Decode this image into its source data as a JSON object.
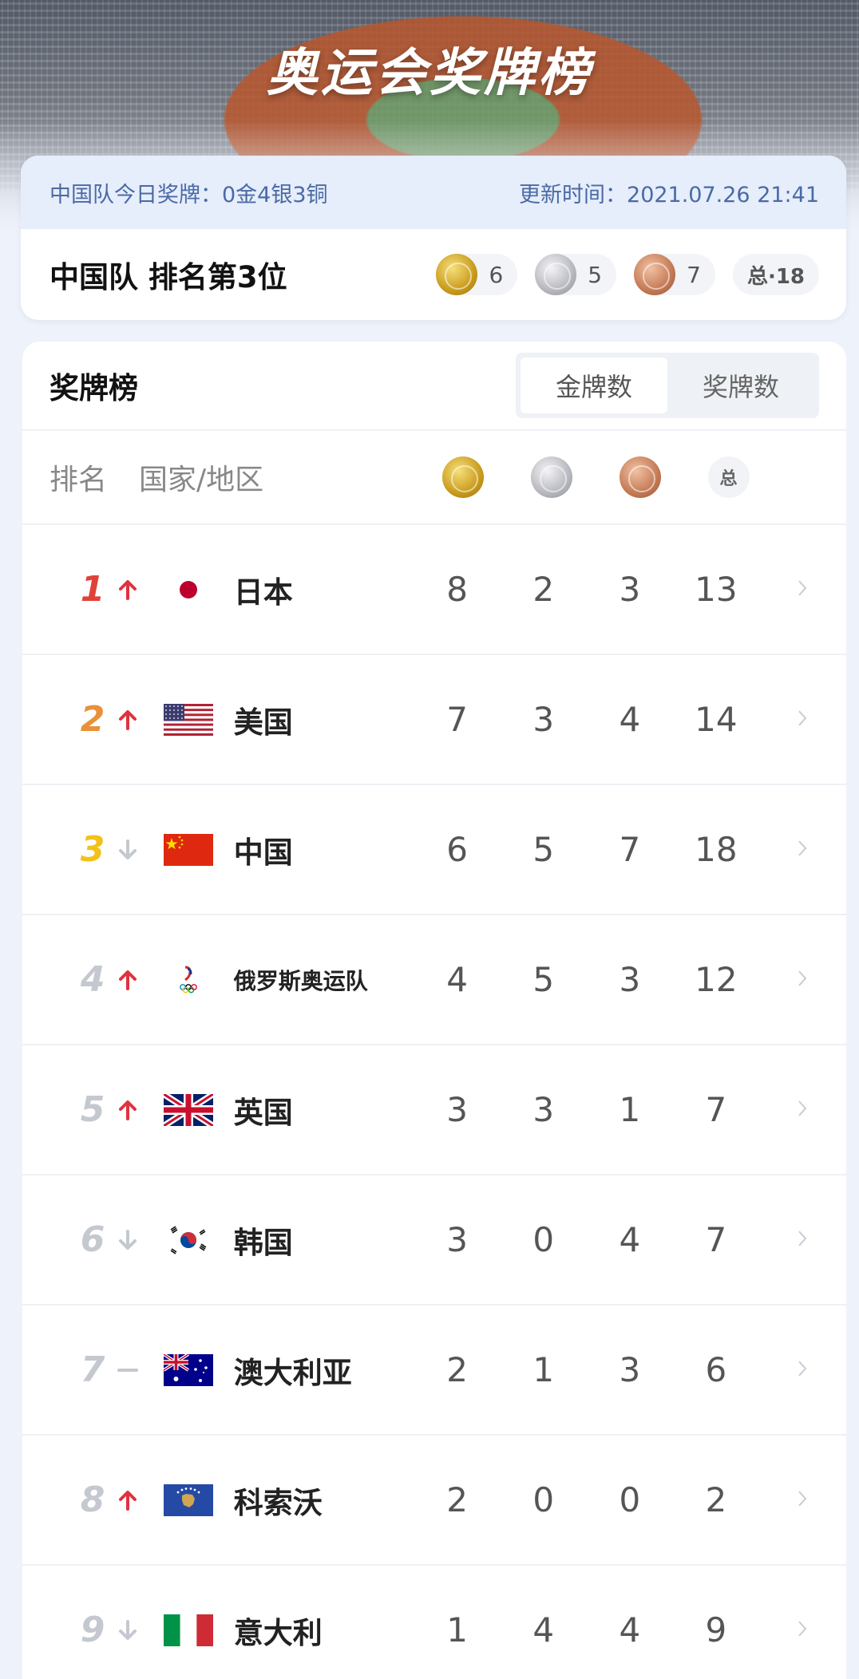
{
  "header": {
    "title": "奥运会奖牌榜"
  },
  "summary": {
    "today_label": "中国队今日奖牌：0金4银3铜",
    "update_label": "更新时间：2021.07.26 21:41",
    "rank_title": "中国队 排名第3位",
    "gold": "6",
    "silver": "5",
    "bronze": "7",
    "total": "总·18"
  },
  "board": {
    "title": "奖牌榜",
    "toggle": [
      "金牌数",
      "奖牌数"
    ],
    "active_toggle": "金牌数",
    "col_rank": "排名",
    "col_country": "国家/地区",
    "col_total_icon": "总"
  },
  "colors": {
    "rank1": "#e0423a",
    "rank2": "#e8913a",
    "rank3": "#f2c21b",
    "rank_other": "#c4c8cf",
    "arrow_up": "#e0323f",
    "arrow_down": "#c4c8cf"
  },
  "rows": [
    {
      "rank": "1",
      "trend": "up",
      "flag": "japan",
      "name": "日本",
      "gold": "8",
      "silver": "2",
      "bronze": "3",
      "total": "13"
    },
    {
      "rank": "2",
      "trend": "up",
      "flag": "usa",
      "name": "美国",
      "gold": "7",
      "silver": "3",
      "bronze": "4",
      "total": "14"
    },
    {
      "rank": "3",
      "trend": "down",
      "flag": "china",
      "name": "中国",
      "gold": "6",
      "silver": "5",
      "bronze": "7",
      "total": "18"
    },
    {
      "rank": "4",
      "trend": "up",
      "flag": "roc",
      "name": "俄罗斯奥运队",
      "gold": "4",
      "silver": "5",
      "bronze": "3",
      "total": "12"
    },
    {
      "rank": "5",
      "trend": "up",
      "flag": "uk",
      "name": "英国",
      "gold": "3",
      "silver": "3",
      "bronze": "1",
      "total": "7"
    },
    {
      "rank": "6",
      "trend": "down",
      "flag": "korea",
      "name": "韩国",
      "gold": "3",
      "silver": "0",
      "bronze": "4",
      "total": "7"
    },
    {
      "rank": "7",
      "trend": "same",
      "flag": "australia",
      "name": "澳大利亚",
      "gold": "2",
      "silver": "1",
      "bronze": "3",
      "total": "6"
    },
    {
      "rank": "8",
      "trend": "up",
      "flag": "kosovo",
      "name": "科索沃",
      "gold": "2",
      "silver": "0",
      "bronze": "0",
      "total": "2"
    },
    {
      "rank": "9",
      "trend": "down",
      "flag": "italy",
      "name": "意大利",
      "gold": "1",
      "silver": "4",
      "bronze": "4",
      "total": "9"
    }
  ]
}
